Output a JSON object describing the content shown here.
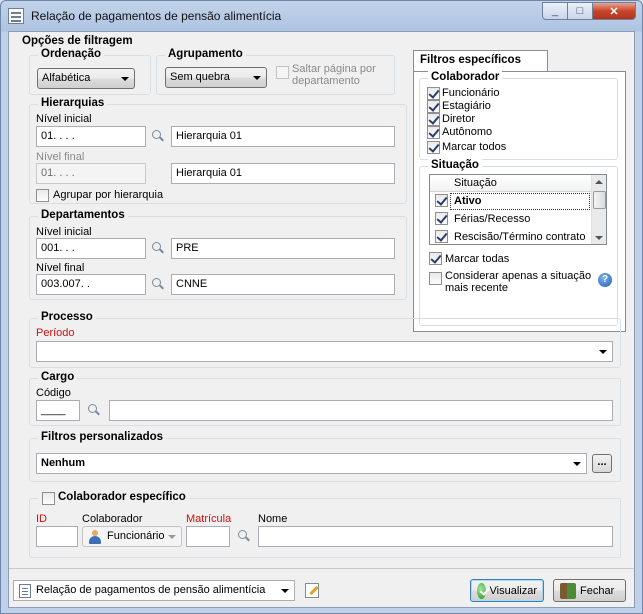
{
  "window": {
    "title": "Relação de pagamentos de pensão alimentícia",
    "caption_min": "_",
    "caption_max": "□",
    "caption_close": "✕"
  },
  "filter_options": {
    "title": "Opções de filtragem",
    "ordering": {
      "label": "Ordenação",
      "value": "Alfabética"
    },
    "grouping": {
      "label": "Agrupamento",
      "value": "Sem quebra",
      "skip_page_label": "Saltar página por departamento"
    },
    "hierarchies": {
      "label": "Hierarquias",
      "initial_label": "Nível inicial",
      "initial_code": "01.  .  .  .",
      "initial_desc": "Hierarquia 01",
      "final_label": "Nível final",
      "final_code": "01.  .  .  .",
      "final_desc": "Hierarquia 01",
      "group_label": "Agrupar por hierarquia"
    },
    "departments": {
      "label": "Departamentos",
      "initial_label": "Nível inicial",
      "initial_code": "001.  .  .",
      "initial_desc": "PRE",
      "final_label": "Nível final",
      "final_code": "003.007.  .",
      "final_desc": "CNNE"
    }
  },
  "specific_filters": {
    "tab_label": "Filtros específicos",
    "employee": {
      "label": "Colaborador",
      "items": [
        {
          "label": "Funcionário",
          "checked": true
        },
        {
          "label": "Estagiário",
          "checked": true
        },
        {
          "label": "Diretor",
          "checked": true
        },
        {
          "label": "Autônomo",
          "checked": true
        },
        {
          "label": "Marcar todos",
          "checked": true
        }
      ]
    },
    "situation": {
      "label": "Situação",
      "column": "Situação",
      "rows": [
        {
          "label": "Ativo",
          "checked": true
        },
        {
          "label": "Férias/Recesso",
          "checked": true
        },
        {
          "label": "Rescisão/Término contrato",
          "checked": true
        }
      ],
      "mark_all_label": "Marcar todas",
      "recent_label": "Considerar apenas a situação mais recente"
    }
  },
  "process": {
    "label": "Processo",
    "period_label": "Período",
    "period_value": ""
  },
  "cargo": {
    "label": "Cargo",
    "code_label": "Código",
    "code_value": "____",
    "desc_value": ""
  },
  "custom_filters": {
    "label": "Filtros personalizados",
    "value": "Nenhum",
    "ellipsis": "..."
  },
  "specific_employee": {
    "label": "Colaborador específico",
    "id_label": "ID",
    "employee_label": "Colaborador",
    "employee_value": "Funcionário",
    "registration_label": "Matrícula",
    "name_label": "Nome"
  },
  "footer": {
    "report_value": "Relação de pagamentos de pensão alimentícia",
    "view_button": "Visualizar",
    "close_button": "Fechar"
  }
}
